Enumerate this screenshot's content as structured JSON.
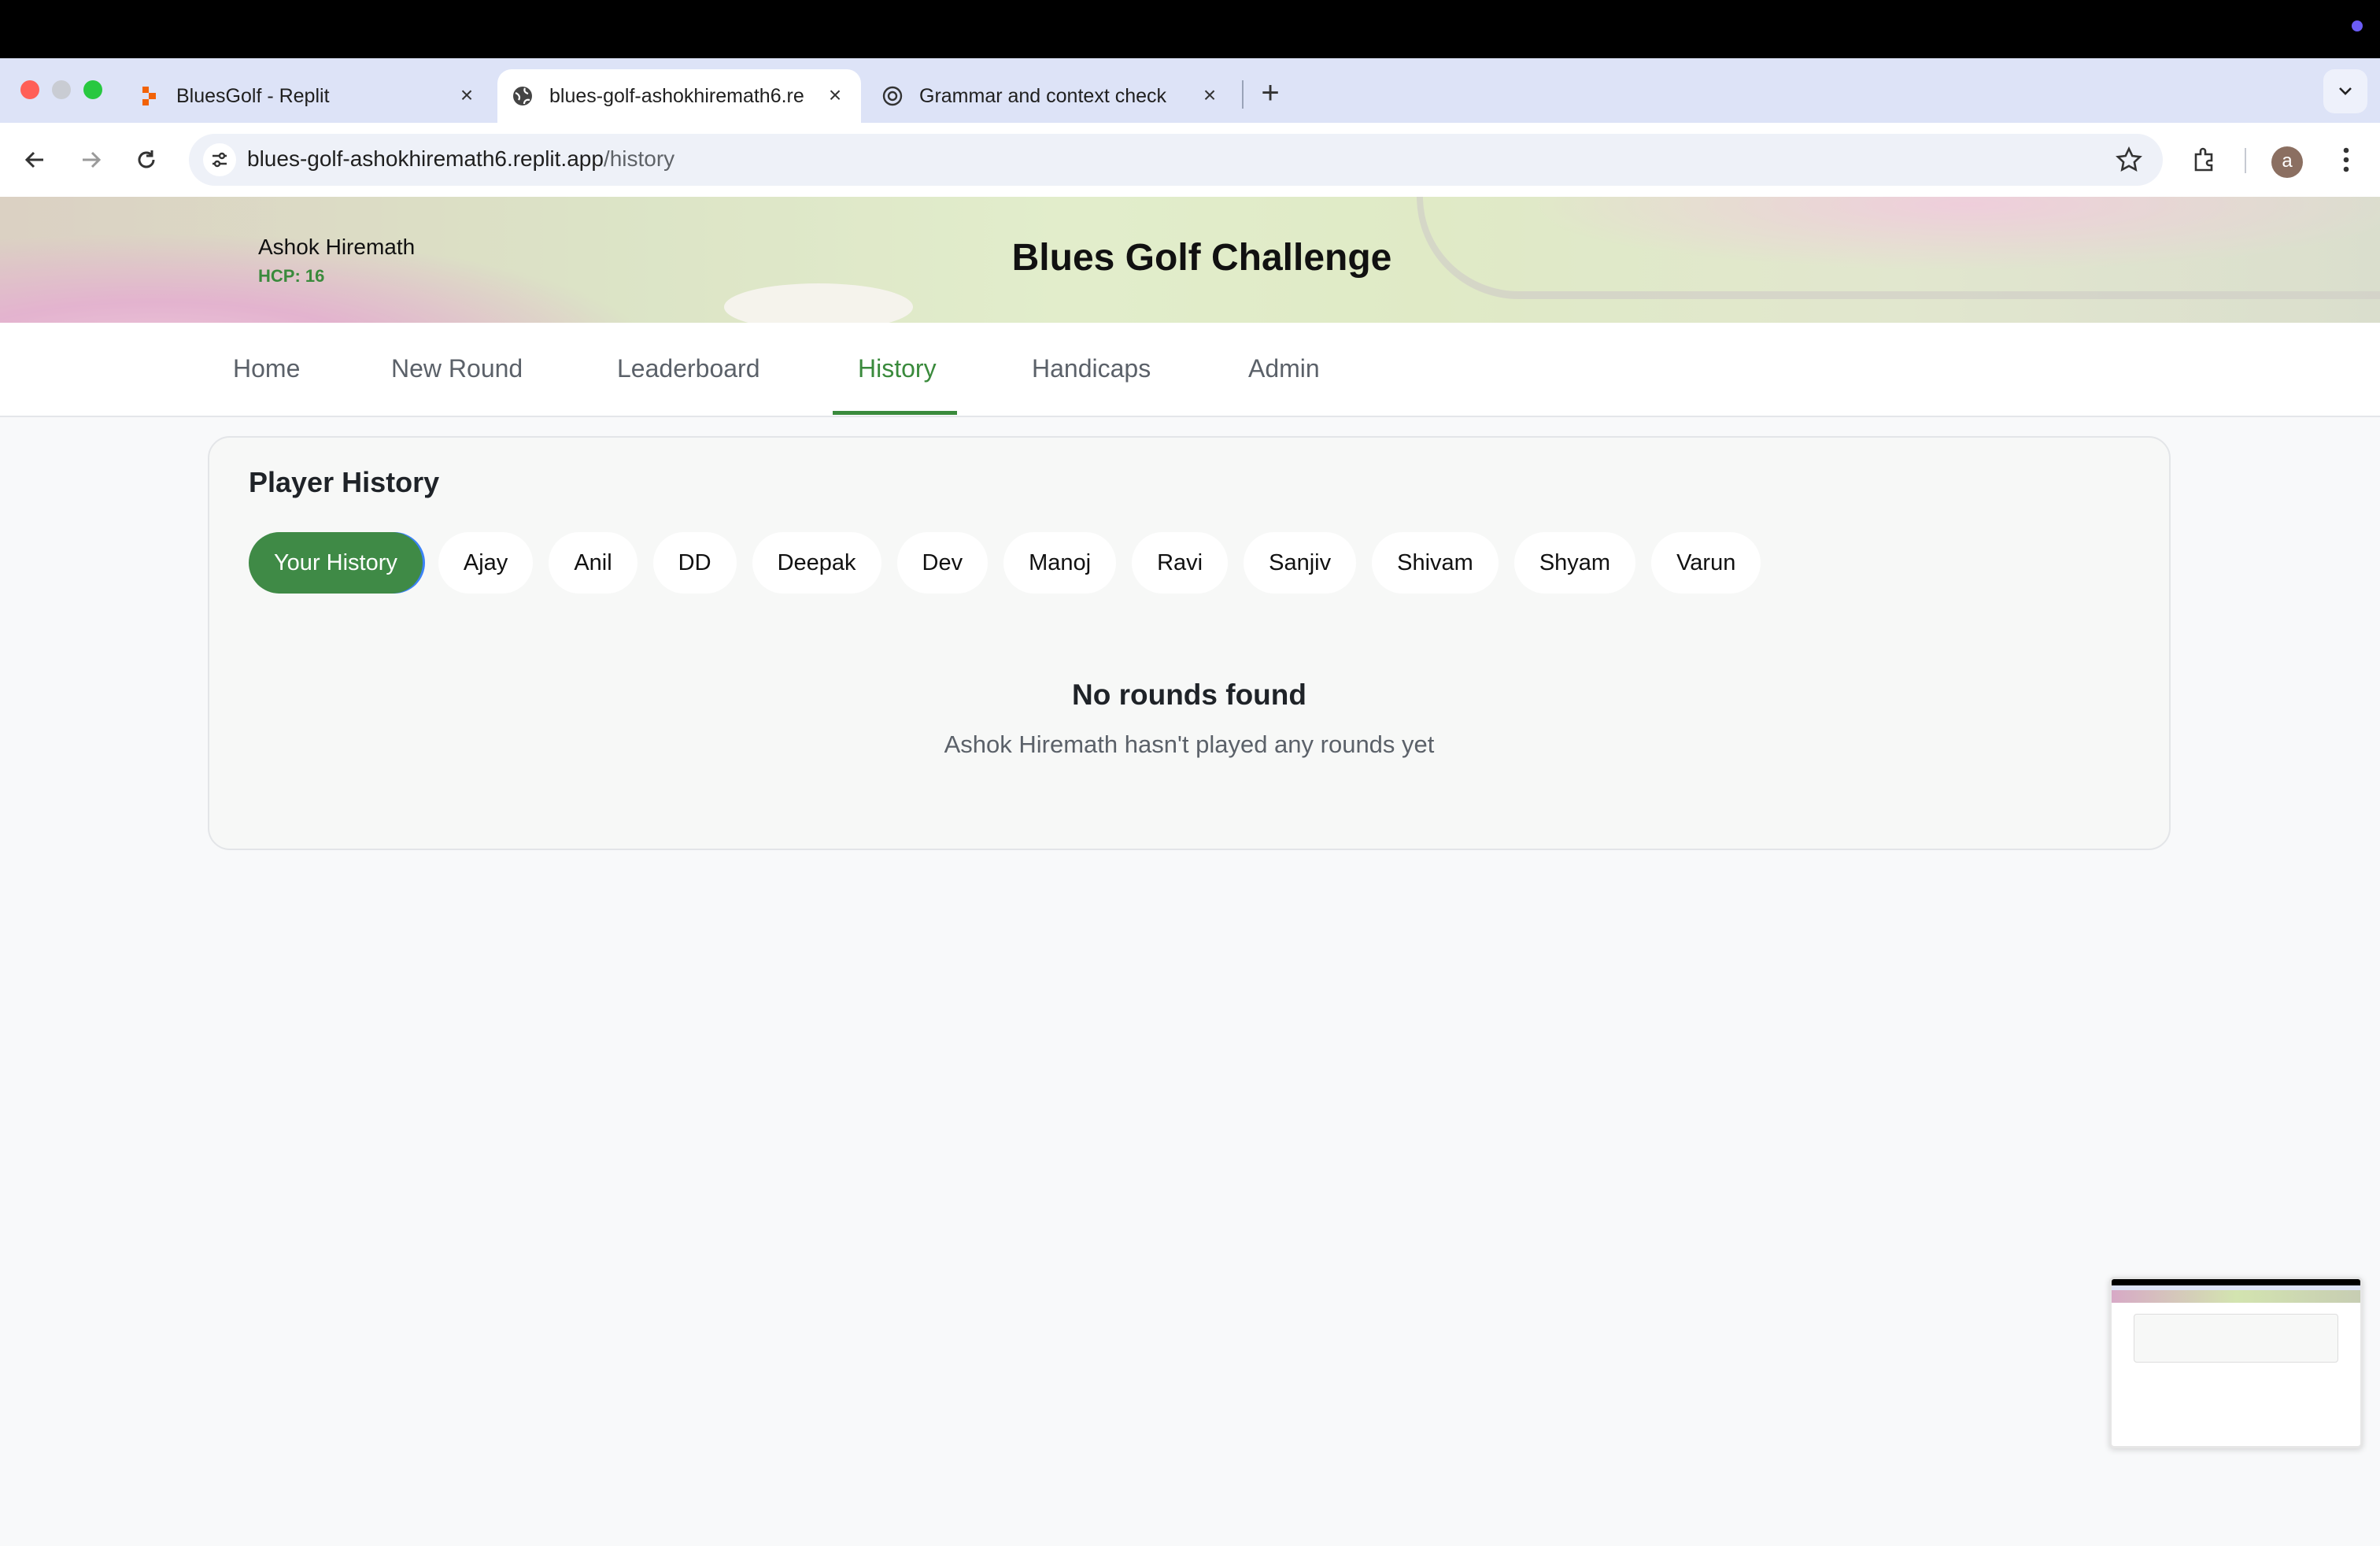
{
  "browser": {
    "tabs": [
      {
        "title": "BluesGolf - Replit",
        "icon": "replit-icon"
      },
      {
        "title": "blues-golf-ashokhiremath6.re",
        "icon": "globe-icon"
      },
      {
        "title": "Grammar and context check",
        "icon": "openai-icon"
      }
    ],
    "active_tab": 1,
    "url_host": "blues-golf-ashokhiremath6.replit.app",
    "url_path": "/history",
    "profile_initial": "a"
  },
  "header": {
    "user_name": "Ashok Hiremath",
    "handicap": "HCP: 16",
    "site_title": "Blues Golf Challenge"
  },
  "nav": {
    "items": [
      "Home",
      "New Round",
      "Leaderboard",
      "History",
      "Handicaps",
      "Admin"
    ],
    "active": "History"
  },
  "history": {
    "title": "Player History",
    "players": [
      "Your History",
      "Ajay",
      "Anil",
      "DD",
      "Deepak",
      "Dev",
      "Manoj",
      "Ravi",
      "Sanjiv",
      "Shivam",
      "Shyam",
      "Varun"
    ],
    "selected": "Your History",
    "empty_title": "No rounds found",
    "empty_message": "Ashok Hiremath hasn't played any rounds yet"
  },
  "colors": {
    "accent": "#3a8a3c",
    "chip_active": "#3f8a46",
    "focus_ring": "#3b82f6"
  }
}
